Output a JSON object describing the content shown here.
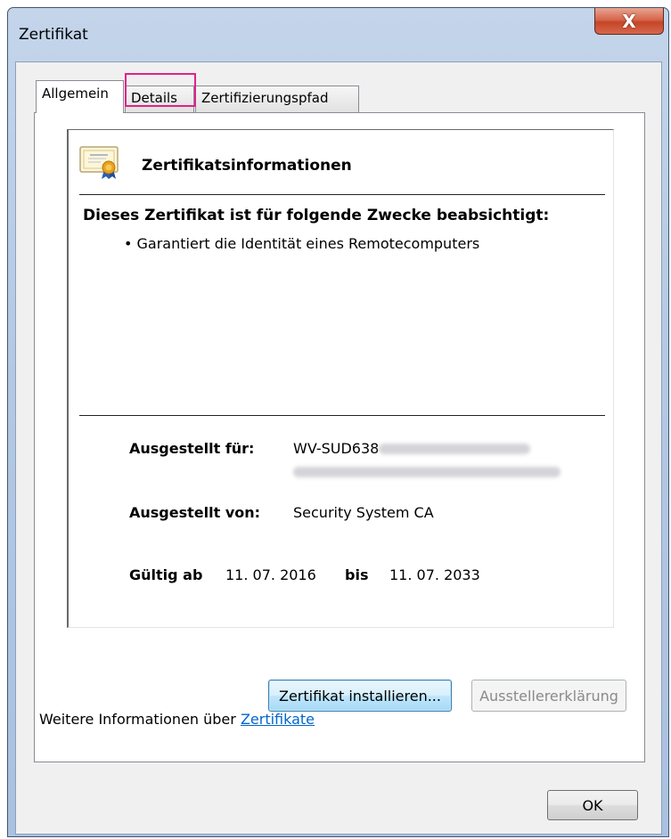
{
  "window": {
    "title": "Zertifikat",
    "close_glyph": "X"
  },
  "tabs": [
    {
      "label": "Allgemein",
      "active": true
    },
    {
      "label": "Details",
      "active": false,
      "highlighted": true
    },
    {
      "label": "Zertifizierungspfad",
      "active": false
    }
  ],
  "general": {
    "icon": "certificate-icon",
    "info_title": "Zertifikatsinformationen",
    "purpose_heading": "Dieses Zertifikat ist für folgende Zwecke beabsichtigt:",
    "purposes": [
      "• Garantiert die Identität eines Remotecomputers"
    ],
    "issued_to_label": "Ausgestellt für:",
    "issued_to_value": "WV-SUD638",
    "issued_by_label": "Ausgestellt von:",
    "issued_by_value": "Security System CA",
    "valid_from_label": "Gültig ab",
    "valid_from": "11. 07. 2016",
    "valid_to_label": "bis",
    "valid_to": "11. 07. 2033"
  },
  "buttons": {
    "install": "Zertifikat installieren...",
    "issuer_statement": "Ausstellererklärung",
    "ok": "OK"
  },
  "footer": {
    "more_info_prefix": "Weitere Informationen über ",
    "more_info_link": "Zertifikate"
  },
  "colors": {
    "highlight": "#e0228a",
    "link": "#0066cc",
    "close_button": "#c44627"
  }
}
